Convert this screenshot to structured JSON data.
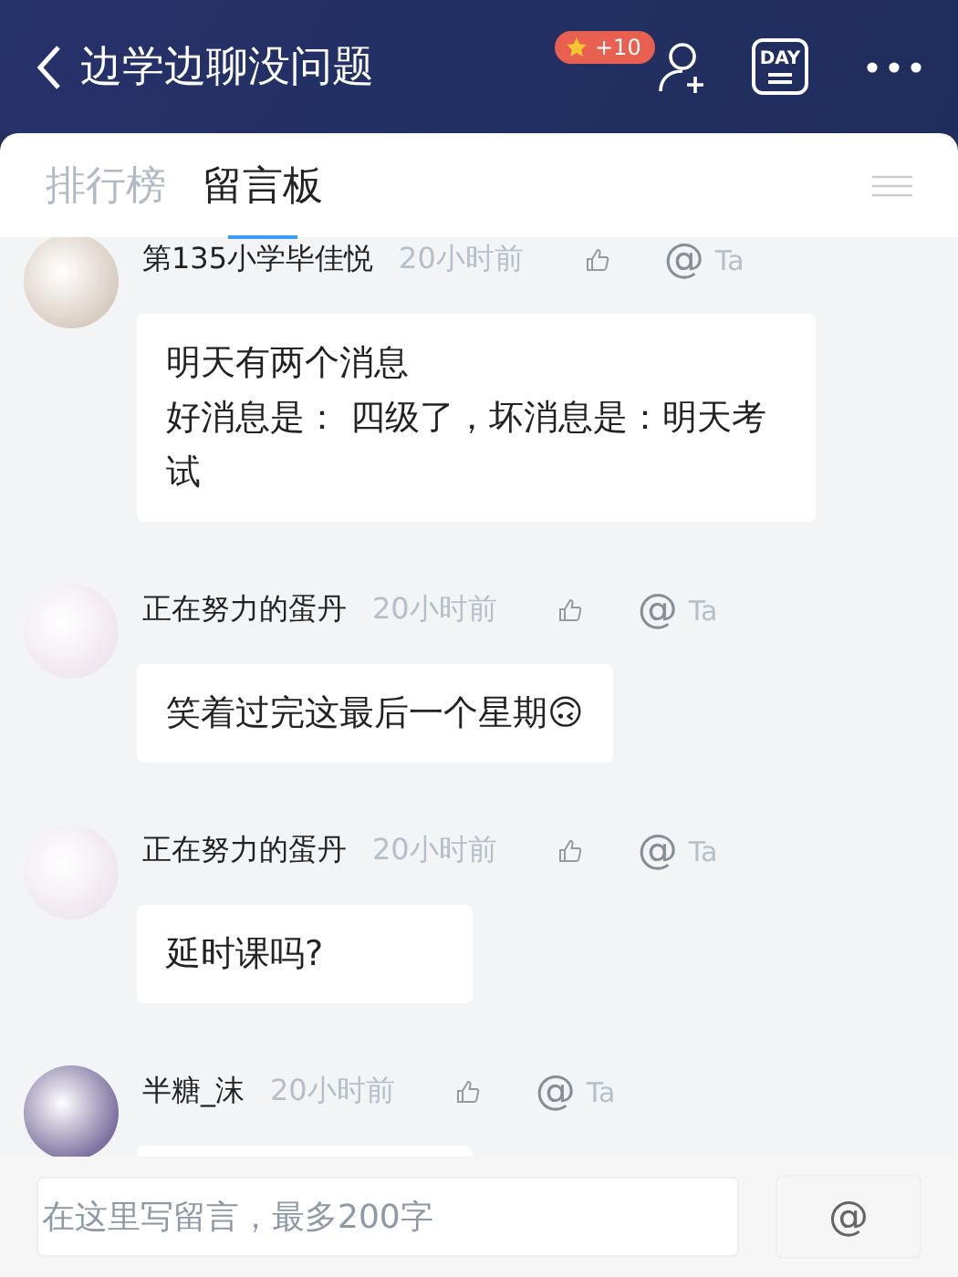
{
  "header": {
    "title": "边学边聊没问题",
    "badge": "+10",
    "day_label": "DAY"
  },
  "tabs": [
    {
      "label": "排行榜",
      "selected": false
    },
    {
      "label": "留言板",
      "selected": true
    }
  ],
  "messages": [
    {
      "author": "第135小学毕佳悦",
      "time": "20小时前",
      "mention_icon": "@",
      "mention_label": "Ta",
      "lines": [
        "明天有两个消息",
        "好消息是： 四级了，坏消息是：明天考试"
      ]
    },
    {
      "author": "正在努力的蛋丹",
      "time": "20小时前",
      "mention_icon": "@",
      "mention_label": "Ta",
      "lines": [
        "笑着过完这最后一个星期🙃"
      ]
    },
    {
      "author": "正在努力的蛋丹",
      "time": "20小时前",
      "mention_icon": "@",
      "mention_label": "Ta",
      "lines": [
        "延时课吗?"
      ]
    },
    {
      "author": "半糖_沫",
      "time": "20小时前",
      "mention_icon": "@",
      "mention_label": "Ta"
    }
  ],
  "composer": {
    "placeholder": "在这里写留言，最多200字",
    "send_label": "@"
  }
}
